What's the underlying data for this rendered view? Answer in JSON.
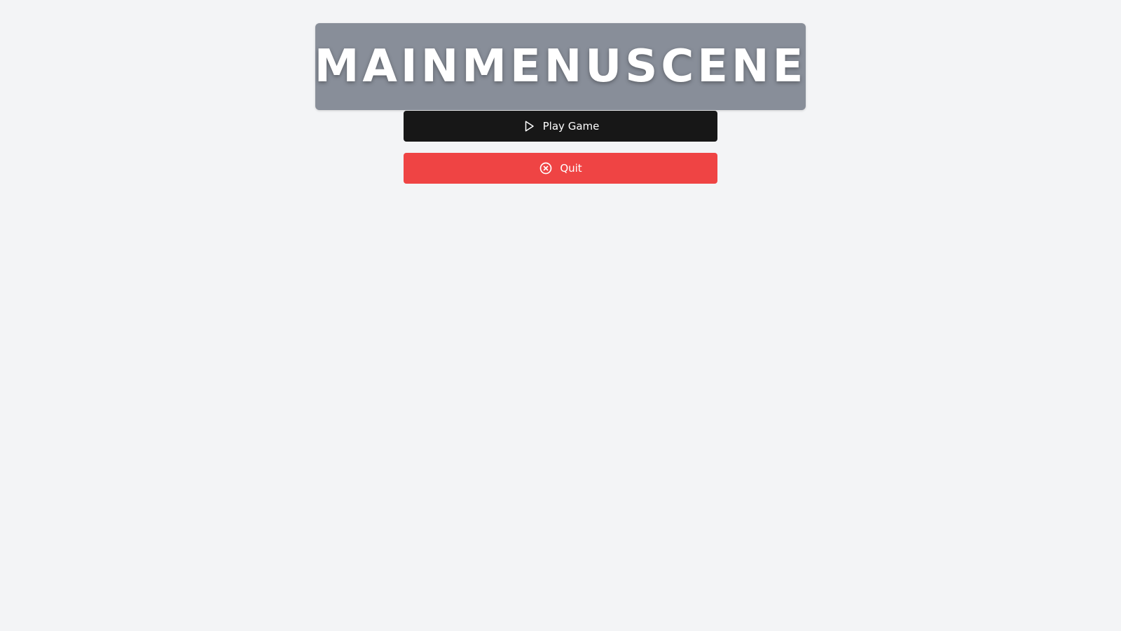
{
  "title": "MAINMENUSCENE",
  "menu": {
    "play": {
      "label": "Play Game",
      "icon": "play-icon"
    },
    "quit": {
      "label": "Quit",
      "icon": "close-circle-icon"
    }
  },
  "colors": {
    "background": "#f3f4f6",
    "banner": "#888e99",
    "play_button": "#171717",
    "quit_button": "#ef4444",
    "text": "#ffffff"
  }
}
